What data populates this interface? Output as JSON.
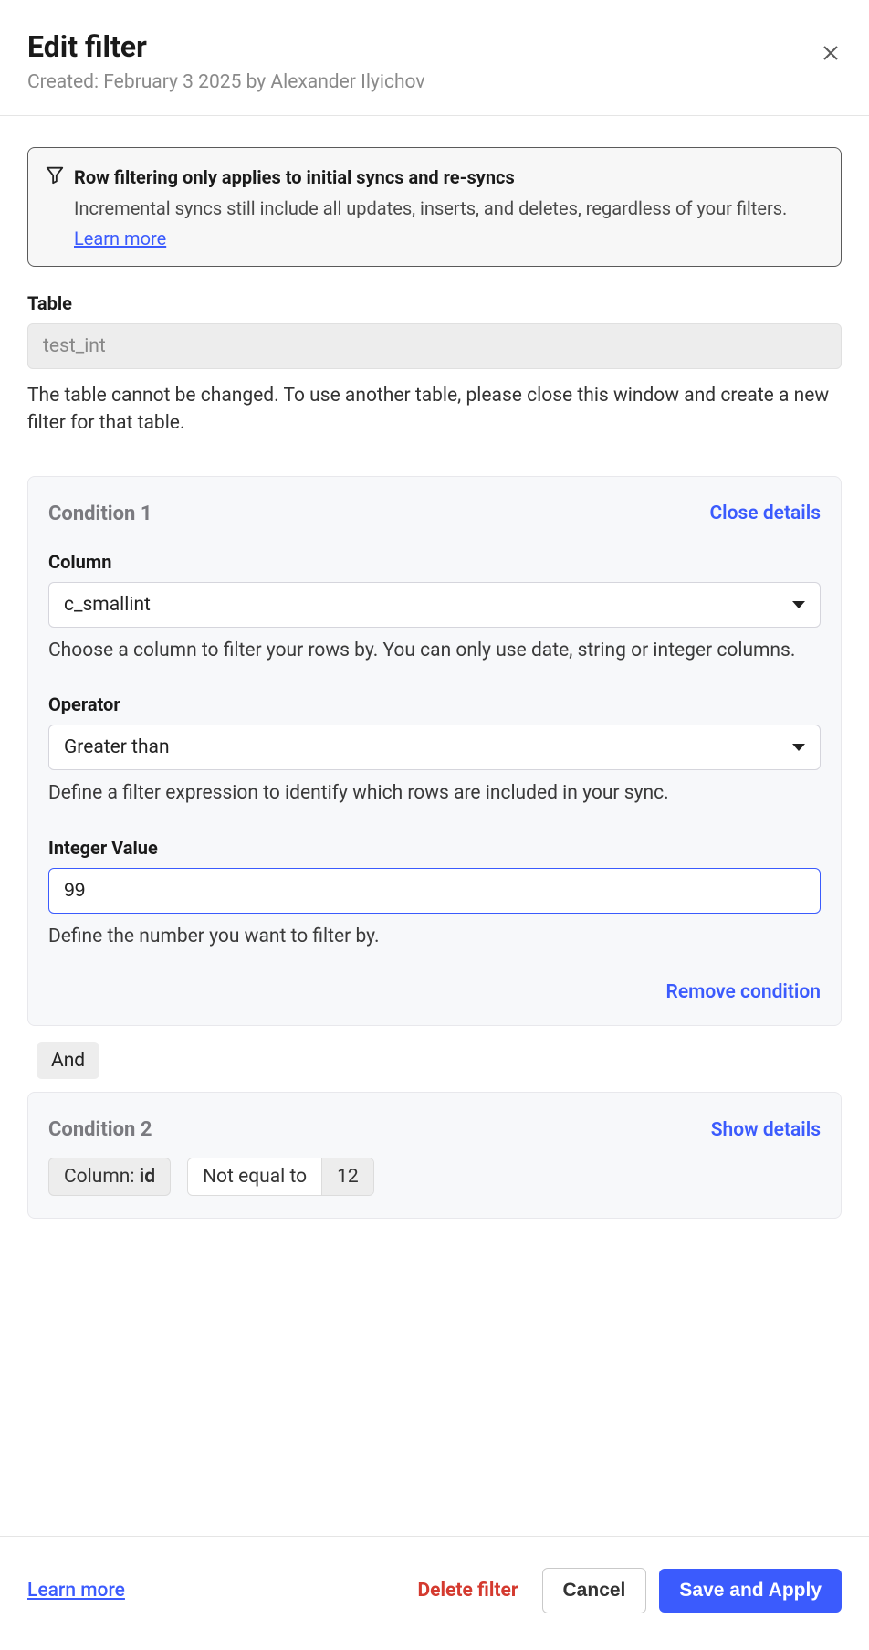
{
  "header": {
    "title": "Edit filter",
    "subtitle": "Created: February 3 2025 by Alexander Ilyichov"
  },
  "infoBox": {
    "title": "Row filtering only applies to initial syncs and re-syncs",
    "desc": "Incremental syncs still include all updates, inserts, and deletes, regardless of your filters.",
    "learnMore": "Learn more"
  },
  "tableField": {
    "label": "Table",
    "value": "test_int",
    "helper": "The table cannot be changed. To use another table, please close this window and create a new filter for that table."
  },
  "condition1": {
    "title": "Condition 1",
    "toggle": "Close details",
    "column": {
      "label": "Column",
      "value": "c_smallint",
      "helper": "Choose a column to filter your rows by. You can only use date, string or integer columns."
    },
    "operator": {
      "label": "Operator",
      "value": "Greater than",
      "helper": "Define a filter expression to identify which rows are included in your sync."
    },
    "value": {
      "label": "Integer Value",
      "value": "99",
      "helper": "Define the number you want to filter by."
    },
    "remove": "Remove condition"
  },
  "joiner": "And",
  "condition2": {
    "title": "Condition 2",
    "toggle": "Show details",
    "columnLabel": "Column: ",
    "columnValue": "id",
    "operator": "Not equal to",
    "value": "12"
  },
  "footer": {
    "learnMore": "Learn more",
    "delete": "Delete filter",
    "cancel": "Cancel",
    "save": "Save and Apply"
  }
}
